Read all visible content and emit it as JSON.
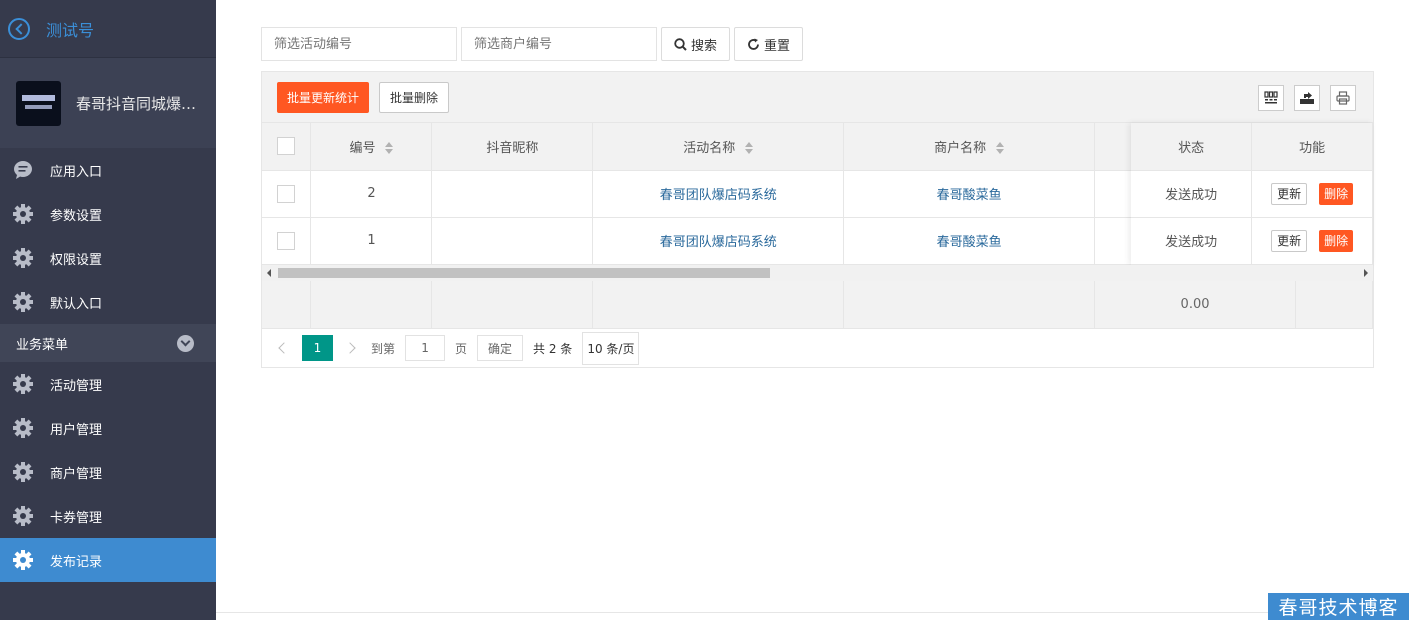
{
  "sidebar": {
    "title": "测试号",
    "profile_name": "春哥抖音同城爆…",
    "top_items": [
      {
        "label": "应用入口",
        "icon": "chat-bubble-icon"
      },
      {
        "label": "参数设置",
        "icon": "gear-icon"
      },
      {
        "label": "权限设置",
        "icon": "gear-icon"
      },
      {
        "label": "默认入口",
        "icon": "gear-icon"
      }
    ],
    "section_label": "业务菜单",
    "business_items": [
      {
        "label": "活动管理",
        "icon": "gear-icon"
      },
      {
        "label": "用户管理",
        "icon": "gear-icon"
      },
      {
        "label": "商户管理",
        "icon": "gear-icon"
      },
      {
        "label": "卡券管理",
        "icon": "gear-icon"
      },
      {
        "label": "发布记录",
        "icon": "gear-icon",
        "active": true
      }
    ]
  },
  "filters": {
    "activity_placeholder": "筛选活动编号",
    "merchant_placeholder": "筛选商户编号",
    "search_label": "搜索",
    "reset_label": "重置"
  },
  "toolbar": {
    "batch_update_label": "批量更新统计",
    "batch_delete_label": "批量删除"
  },
  "table": {
    "headers": {
      "id": "编号",
      "nickname": "抖音昵称",
      "activity": "活动名称",
      "merchant": "商户名称",
      "status": "状态",
      "actions": "功能"
    },
    "rows": [
      {
        "id": "2",
        "nickname": "",
        "activity": "春哥团队爆店码系统",
        "merchant": "春哥酸菜鱼",
        "status": "发送成功"
      },
      {
        "id": "1",
        "nickname": "",
        "activity": "春哥团队爆店码系统",
        "merchant": "春哥酸菜鱼",
        "status": "发送成功"
      }
    ],
    "update_label": "更新",
    "delete_label": "删除",
    "total_value": "0.00"
  },
  "pagination": {
    "current_page": "1",
    "goto_label": "到第",
    "page_input": "1",
    "page_label": "页",
    "confirm_label": "确定",
    "total_label": "共 2 条",
    "page_size_label": "10 条/页"
  },
  "watermark": "春哥技术博客",
  "colors": {
    "accent": "#3e8bd0",
    "orange": "#ff5722",
    "teal": "#009688",
    "sidebar": "#363a4c"
  }
}
